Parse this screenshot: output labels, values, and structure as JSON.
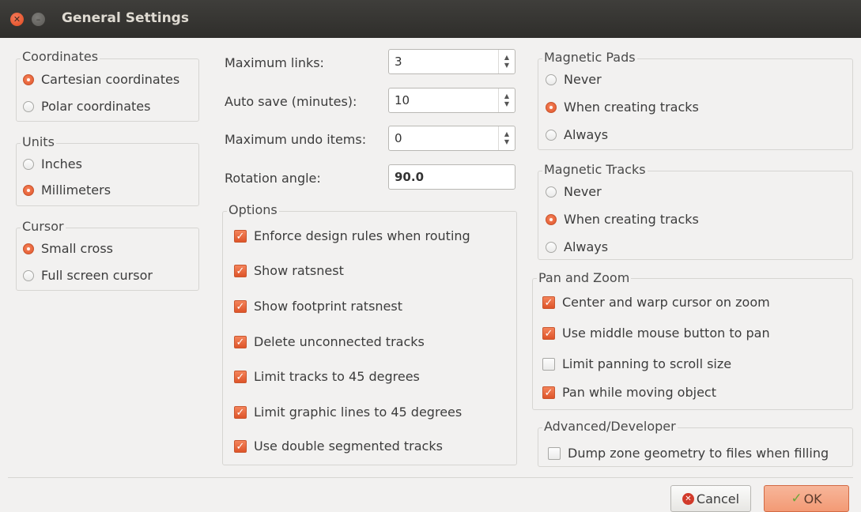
{
  "window": {
    "title": "General Settings",
    "close_glyph": "✕",
    "minimize_glyph": "–"
  },
  "coordinates": {
    "label": "Coordinates",
    "options": [
      "Cartesian coordinates",
      "Polar coordinates"
    ],
    "selected": "Cartesian coordinates"
  },
  "units": {
    "label": "Units",
    "options": [
      "Inches",
      "Millimeters"
    ],
    "selected": "Millimeters"
  },
  "cursor": {
    "label": "Cursor",
    "options": [
      "Small cross",
      "Full screen cursor"
    ],
    "selected": "Small cross"
  },
  "fields": {
    "max_links": {
      "label": "Maximum links:",
      "value": "3"
    },
    "auto_save": {
      "label": "Auto save (minutes):",
      "value": "10"
    },
    "max_undo": {
      "label": "Maximum undo items:",
      "value": "0"
    },
    "rotation": {
      "label": "Rotation angle:",
      "value": "90.0"
    }
  },
  "options": {
    "label": "Options",
    "items": [
      {
        "label": "Enforce design rules when routing",
        "checked": true
      },
      {
        "label": "Show ratsnest",
        "checked": true
      },
      {
        "label": "Show footprint ratsnest",
        "checked": true
      },
      {
        "label": "Delete unconnected tracks",
        "checked": true
      },
      {
        "label": "Limit tracks to 45 degrees",
        "checked": true
      },
      {
        "label": "Limit graphic lines to 45 degrees",
        "checked": true
      },
      {
        "label": "Use double segmented tracks",
        "checked": true
      }
    ]
  },
  "magnetic_pads": {
    "label": "Magnetic Pads",
    "options": [
      "Never",
      "When creating tracks",
      "Always"
    ],
    "selected": "When creating tracks"
  },
  "magnetic_tracks": {
    "label": "Magnetic Tracks",
    "options": [
      "Never",
      "When creating tracks",
      "Always"
    ],
    "selected": "When creating tracks"
  },
  "pan_zoom": {
    "label": "Pan and Zoom",
    "items": [
      {
        "label": "Center and warp cursor on zoom",
        "checked": true
      },
      {
        "label": "Use middle mouse button to pan",
        "checked": true
      },
      {
        "label": "Limit panning to scroll size",
        "checked": false
      },
      {
        "label": "Pan while moving object",
        "checked": true
      }
    ]
  },
  "advanced": {
    "label": "Advanced/Developer",
    "items": [
      {
        "label": "Dump zone geometry to files when filling",
        "checked": false
      }
    ]
  },
  "buttons": {
    "cancel": "Cancel",
    "ok": "OK"
  },
  "colors": {
    "accent": "#e2572b",
    "titlebar": "#3c3b37",
    "background": "#f2f1f0"
  }
}
